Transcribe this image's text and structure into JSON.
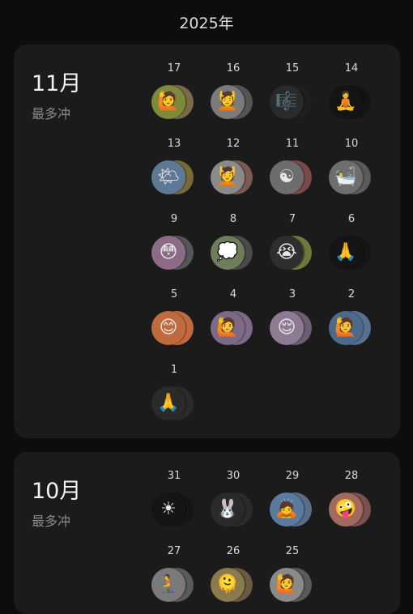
{
  "year_title": "2025年",
  "months": [
    {
      "label": "11月",
      "subtitle": "最多冲",
      "days": [
        {
          "day": "17",
          "emoji": "🙋",
          "icon": "person-raising-hand-icon",
          "front": "#7d8a3a",
          "back": "#7a6a45"
        },
        {
          "day": "16",
          "emoji": "💆",
          "icon": "person-massage-icon",
          "front": "#7b7b7b",
          "back": "#555555"
        },
        {
          "day": "15",
          "emoji": "🎼",
          "icon": "music-score-icon",
          "front": "#2a2a2a",
          "back": "#1f1f1f"
        },
        {
          "day": "14",
          "emoji": "🧘",
          "icon": "person-meditating-icon",
          "front": "#141414",
          "back": "#141414"
        },
        {
          "day": "13",
          "emoji": "🌤",
          "icon": "sun-behind-cloud-icon",
          "front": "#5e7896",
          "back": "#7a6a38"
        },
        {
          "day": "12",
          "emoji": "💆",
          "icon": "person-massage-icon",
          "front": "#8a8a8a",
          "back": "#7a5a55"
        },
        {
          "day": "11",
          "emoji": "☯",
          "icon": "yin-yang-icon",
          "front": "#6d6d6d",
          "back": "#7a4a4a"
        },
        {
          "day": "10",
          "emoji": "🛀",
          "icon": "person-bathing-icon",
          "front": "#6e6e6e",
          "back": "#5a5a5a"
        },
        {
          "day": "9",
          "emoji": "😳",
          "icon": "flushed-face-icon",
          "front": "#8d6a86",
          "back": "#555555"
        },
        {
          "day": "8",
          "emoji": "💭",
          "icon": "thought-balloon-icon",
          "front": "#6e7e5a",
          "back": "#4a4a4a"
        },
        {
          "day": "7",
          "emoji": "😭",
          "icon": "crying-face-icon",
          "front": "#2e2e2e",
          "back": "#6e7a3a"
        },
        {
          "day": "6",
          "emoji": "🙏",
          "icon": "folded-hands-icon",
          "front": "#151515",
          "back": "#151515"
        },
        {
          "day": "5",
          "emoji": "😊",
          "icon": "smiling-face-icon",
          "front": "#c06a3e",
          "back": "#c06a3e"
        },
        {
          "day": "4",
          "emoji": "🙋",
          "icon": "person-raising-hand-icon",
          "front": "#7c6a86",
          "back": "#7c6a86"
        },
        {
          "day": "3",
          "emoji": "😌",
          "icon": "relieved-face-icon",
          "front": "#8e7a92",
          "back": "#6e5e72"
        },
        {
          "day": "2",
          "emoji": "🙋",
          "icon": "person-raising-hand-icon",
          "front": "#4e6a8a",
          "back": "#5a7090"
        },
        {
          "day": "1",
          "emoji": "🙏",
          "icon": "folded-hands-icon",
          "front": "#2a2a2a",
          "back": "#2a2a2a"
        }
      ]
    },
    {
      "label": "10月",
      "subtitle": "最多冲",
      "days": [
        {
          "day": "31",
          "emoji": "☀",
          "icon": "sun-icon",
          "front": "#151515",
          "back": "#151515"
        },
        {
          "day": "30",
          "emoji": "🐰",
          "icon": "rabbit-face-icon",
          "front": "#2a2a2a",
          "back": "#2a2a2a"
        },
        {
          "day": "29",
          "emoji": "🙇",
          "icon": "person-bowing-icon",
          "front": "#5a7aa0",
          "back": "#5a6e8a"
        },
        {
          "day": "28",
          "emoji": "🤪",
          "icon": "zany-face-icon",
          "front": "#a06a5e",
          "back": "#7a5050"
        },
        {
          "day": "27",
          "emoji": "🧎",
          "icon": "person-kneeling-icon",
          "front": "#7a7a7a",
          "back": "#5a5a5a"
        },
        {
          "day": "26",
          "emoji": "🫠",
          "icon": "melting-face-icon",
          "front": "#8a7a50",
          "back": "#6a5a40"
        },
        {
          "day": "25",
          "emoji": "🙋",
          "icon": "person-raising-hand-icon",
          "front": "#8a8a8a",
          "back": "#5a5a5a"
        }
      ]
    }
  ]
}
